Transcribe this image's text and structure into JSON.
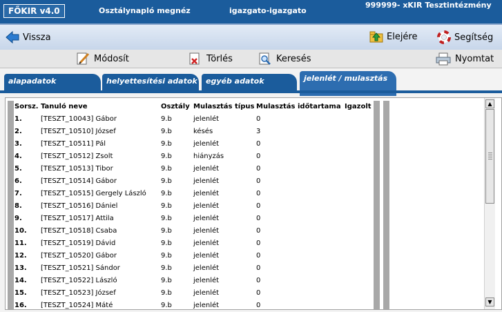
{
  "header": {
    "logo": "FŐKIR v4.0",
    "page_name": "Osztálynapló megnéz",
    "user": "igazgato-igazgato",
    "institution": "999999- xKIR Tesztintézmény"
  },
  "nav": {
    "back": "Vissza",
    "home": "Elejére",
    "help": "Segítség"
  },
  "toolbar": {
    "edit": "Módosít",
    "delete": "Törlés",
    "search": "Keresés",
    "print": "Nyomtat"
  },
  "tabs": [
    {
      "label": "alapadatok",
      "active": false
    },
    {
      "label": "helyettesítési adatok",
      "active": false
    },
    {
      "label": "egyéb adatok",
      "active": false
    },
    {
      "label": "jelenlét / mulasztás",
      "active": true
    }
  ],
  "table": {
    "columns": [
      "Sorsz.",
      "Tanuló neve",
      "Osztály",
      "Mulasztás típus",
      "Mulasztás időtartama",
      "Igazolt"
    ],
    "rows": [
      [
        "1.",
        "[TESZT_10043] Gábor",
        "9.b",
        "jelenlét",
        "0",
        ""
      ],
      [
        "2.",
        "[TESZT_10510] József",
        "9.b",
        "késés",
        "3",
        ""
      ],
      [
        "3.",
        "[TESZT_10511] Pál",
        "9.b",
        "jelenlét",
        "0",
        ""
      ],
      [
        "4.",
        "[TESZT_10512] Zsolt",
        "9.b",
        "hiányzás",
        "0",
        ""
      ],
      [
        "5.",
        "[TESZT_10513] Tibor",
        "9.b",
        "jelenlét",
        "0",
        ""
      ],
      [
        "6.",
        "[TESZT_10514] Gábor",
        "9.b",
        "jelenlét",
        "0",
        ""
      ],
      [
        "7.",
        "[TESZT_10515] Gergely László",
        "9.b",
        "jelenlét",
        "0",
        ""
      ],
      [
        "8.",
        "[TESZT_10516] Dániel",
        "9.b",
        "jelenlét",
        "0",
        ""
      ],
      [
        "9.",
        "[TESZT_10517] Attila",
        "9.b",
        "jelenlét",
        "0",
        ""
      ],
      [
        "10.",
        "[TESZT_10518] Csaba",
        "9.b",
        "jelenlét",
        "0",
        ""
      ],
      [
        "11.",
        "[TESZT_10519] Dávid",
        "9.b",
        "jelenlét",
        "0",
        ""
      ],
      [
        "12.",
        "[TESZT_10520] Gábor",
        "9.b",
        "jelenlét",
        "0",
        ""
      ],
      [
        "13.",
        "[TESZT_10521] Sándor",
        "9.b",
        "jelenlét",
        "0",
        ""
      ],
      [
        "14.",
        "[TESZT_10522] László",
        "9.b",
        "jelenlét",
        "0",
        ""
      ],
      [
        "15.",
        "[TESZT_10523] József",
        "9.b",
        "jelenlét",
        "0",
        ""
      ],
      [
        "16.",
        "[TESZT_10524] Máté",
        "9.b",
        "jelenlét",
        "0",
        ""
      ]
    ]
  },
  "icons": {
    "back": "arrow-left-icon",
    "home": "folder-up-icon",
    "help": "lifebuoy-icon",
    "edit": "pencil-document-icon",
    "delete": "delete-document-icon",
    "search": "magnifier-document-icon",
    "print": "printer-icon",
    "scroll_up": "arrow-up-icon",
    "scroll_down": "arrow-down-icon"
  },
  "colors": {
    "brand_blue": "#1b5c9c",
    "tab_active": "#2d6db0",
    "toolbar_bg": "#e6e6e6"
  }
}
